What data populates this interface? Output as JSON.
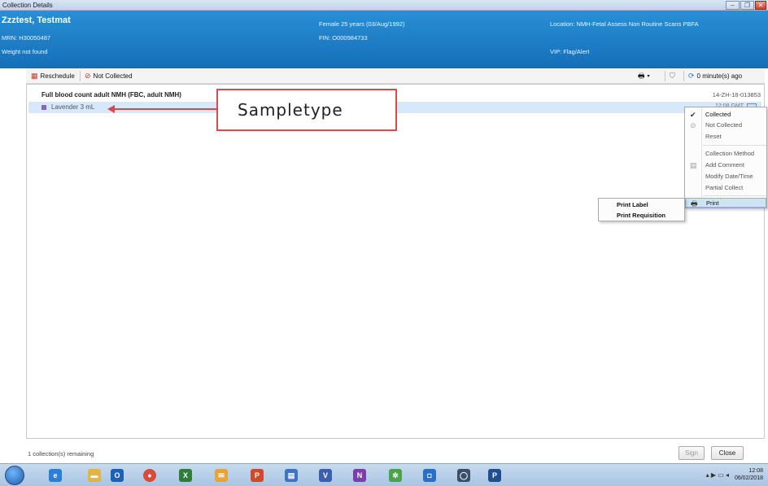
{
  "window": {
    "title": "Collection Details",
    "min_icon": "minimize-icon",
    "restore_icon": "restore-icon",
    "close_icon": "close-icon"
  },
  "banner": {
    "patient_name": "Zzztest, Testmat",
    "mrn": "MRN: H30050487",
    "weight": "Weight not found",
    "demographics": "Female 25 years (03/Aug/1992)",
    "fin": "FIN: O000984733",
    "location": "Location:  NMH-Fetal Assess Non Routine Scans PBFA",
    "vip": "VIP:  Flag/Alert"
  },
  "toolbar": {
    "reschedule": "Reschedule",
    "not_collected": "Not Collected",
    "refresh_text": "0 minute(s) ago"
  },
  "order": {
    "title": "Full blood count adult NMH (FBC, adult NMH)",
    "accession": "14-ZH-18-013853",
    "specimen_label": "Lavender 3 mL",
    "specimen_color": "#8a63c9",
    "time": "12:08 GMT"
  },
  "annotation": {
    "text": "Sampletype"
  },
  "context_menu": {
    "items": [
      "Collected",
      "Not Collected",
      "Reset",
      "Collection Method",
      "Add Comment",
      "Modify Date/Time",
      "Partial Collect",
      "Print"
    ]
  },
  "submenu": {
    "items": [
      "Print Label",
      "Print Requisition"
    ]
  },
  "footer": {
    "remaining": "1 collection(s) remaining",
    "sign": "Sign",
    "close": "Close"
  },
  "taskbar": {
    "time": "12:08",
    "date": "06/02/2018"
  }
}
